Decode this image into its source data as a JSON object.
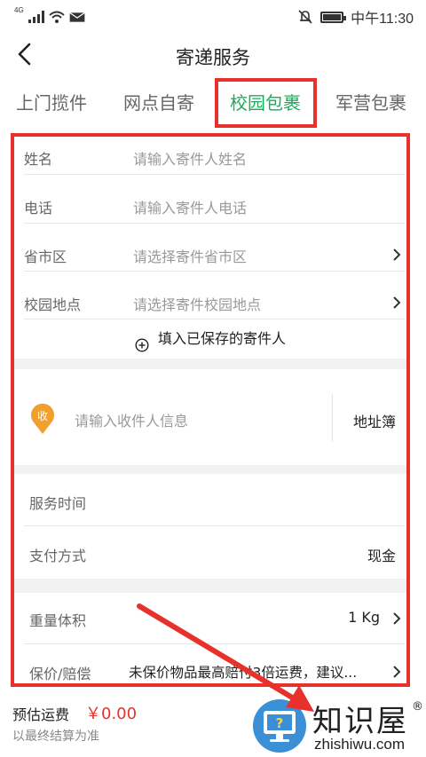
{
  "status_bar": {
    "network": "4G",
    "time": "中午11:30"
  },
  "header": {
    "title": "寄递服务"
  },
  "tabs": [
    {
      "label": "上门揽件",
      "active": false
    },
    {
      "label": "网点自寄",
      "active": false
    },
    {
      "label": "校园包裹",
      "active": true
    },
    {
      "label": "军营包裹",
      "active": false
    }
  ],
  "sender": {
    "name": {
      "label": "姓名",
      "placeholder": "请输入寄件人姓名"
    },
    "phone": {
      "label": "电话",
      "placeholder": "请输入寄件人电话"
    },
    "region": {
      "label": "省市区",
      "placeholder": "请选择寄件省市区"
    },
    "campus": {
      "label": "校园地点",
      "placeholder": "请选择寄件校园地点"
    },
    "saved_link": "填入已保存的寄件人"
  },
  "receiver": {
    "badge": "收",
    "placeholder": "请输入收件人信息",
    "address_book": "地址簿"
  },
  "service": {
    "time_label": "服务时间",
    "payment_label": "支付方式",
    "payment_value": "现金"
  },
  "package": {
    "weight_label": "重量体积",
    "weight_value": "1 Kg",
    "insurance_label": "保价/赔偿",
    "insurance_value": "未保价物品最高赔付3倍运费，建议..."
  },
  "footer": {
    "fee_label": "预估运费",
    "fee_value": "￥0.00",
    "fee_note": "以最终结算为准"
  },
  "watermark": {
    "text": "知识屋",
    "reg": "®",
    "sub": "zhishiwu.com"
  },
  "colors": {
    "accent": "#1aad5b",
    "highlight": "#e8312c",
    "badge": "#f0a030"
  }
}
